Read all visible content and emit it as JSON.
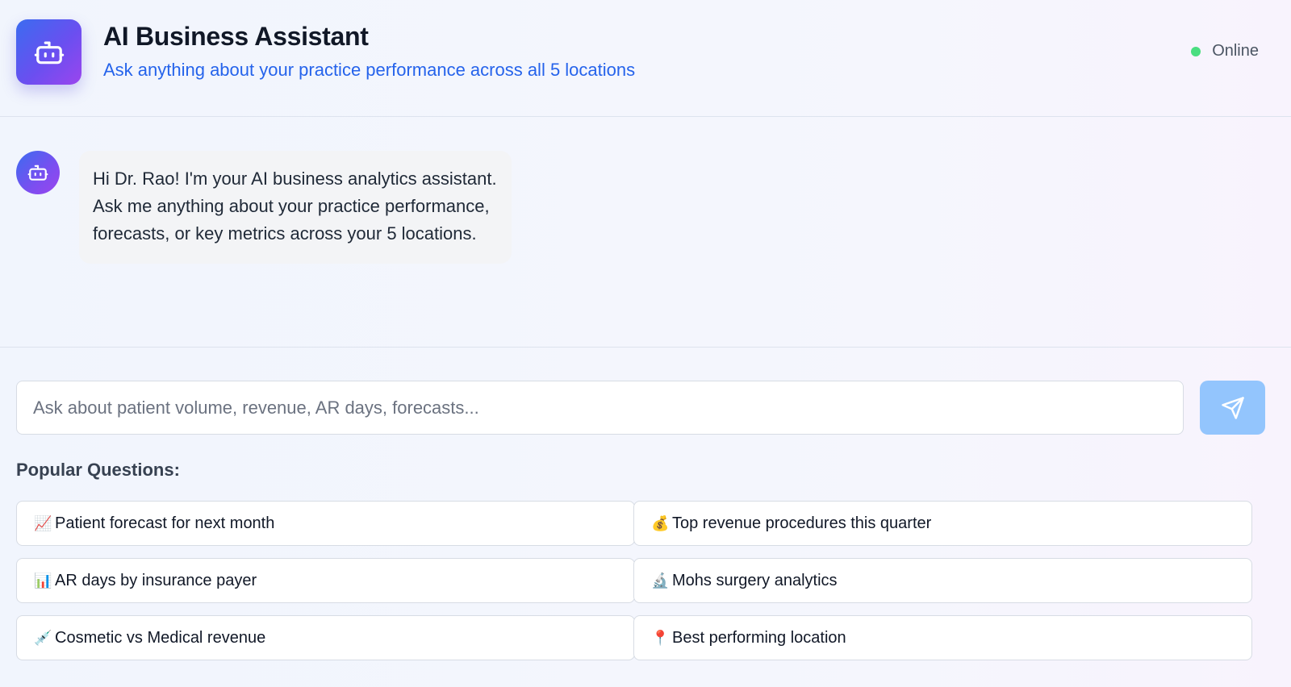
{
  "header": {
    "title": "AI Business Assistant",
    "subtitle": "Ask anything about your practice performance across all 5 locations",
    "status": "Online",
    "status_color": "#4ade80",
    "accent": "#2563eb"
  },
  "chat": {
    "messages": [
      {
        "sender": "bot",
        "text": "Hi Dr. Rao! I'm your AI business analytics assistant. Ask me anything about your practice performance, forecasts, or key metrics across your 5 locations."
      }
    ]
  },
  "input": {
    "placeholder": "Ask about patient volume, revenue, AR days, forecasts...",
    "value": "",
    "send_icon": "send-icon"
  },
  "popular": {
    "heading": "Popular Questions:",
    "items": [
      {
        "icon": "📈",
        "icon_name": "chart-increasing-icon",
        "label": "Patient forecast for next month"
      },
      {
        "icon": "💰",
        "icon_name": "money-bag-icon",
        "label": "Top revenue procedures this quarter"
      },
      {
        "icon": "📊",
        "icon_name": "bar-chart-icon",
        "label": "AR days by insurance payer"
      },
      {
        "icon": "🔬",
        "icon_name": "microscope-icon",
        "label": "Mohs surgery analytics"
      },
      {
        "icon": "💉",
        "icon_name": "syringe-icon",
        "label": "Cosmetic vs Medical revenue"
      },
      {
        "icon": "📍",
        "icon_name": "pin-icon",
        "label": "Best performing location"
      }
    ]
  }
}
